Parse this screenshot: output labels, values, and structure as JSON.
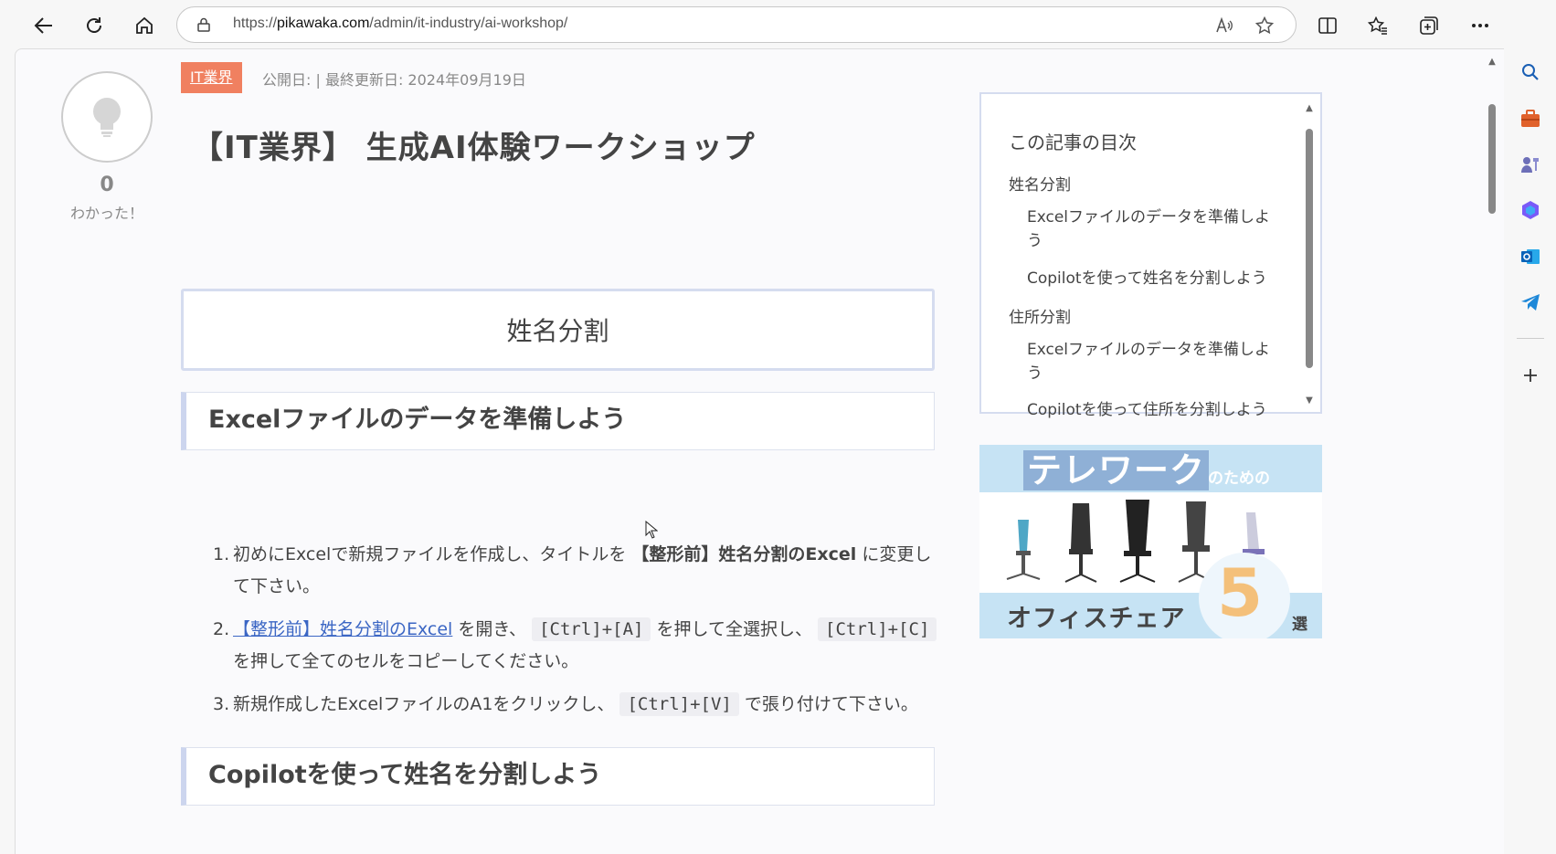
{
  "browser": {
    "url_prefix": "https://",
    "url_host": "pikawaka.com",
    "url_path": "/admin/it-industry/ai-workshop/",
    "icons": [
      "back-icon",
      "refresh-icon",
      "home-icon",
      "lock-icon",
      "read-aloud-icon",
      "favorite-star-icon",
      "split-screen-icon",
      "favorites-icon",
      "collections-icon",
      "more-icon",
      "copilot-icon"
    ],
    "sidebar_icons": [
      "search-icon",
      "tools-icon",
      "games-icon",
      "office-icon",
      "outlook-icon",
      "telegram-icon",
      "add-icon"
    ]
  },
  "article": {
    "category": "IT業界",
    "meta": "公開日:  |  最終更新日: 2024年09月19日",
    "title": "【IT業界】 生成AI体験ワークショップ",
    "like_count": "0",
    "like_label": "わかった！",
    "section_title": "姓名分割",
    "h3_1": "Excelファイルのデータを準備しよう",
    "h3_2": "Copilotを使って姓名を分割しよう",
    "steps": {
      "s1": {
        "num": "1.",
        "pre": "初めにExcelで新規ファイルを作成し、タイトルを ",
        "bold": "【整形前】姓名分割のExcel",
        "post": " に変更して下さい。"
      },
      "s2": {
        "num": "2.",
        "link": "【整形前】姓名分割のExcel",
        "mid1": " を開き、 ",
        "kbd1": "[Ctrl]+[A]",
        "mid2": " を押して全選択し、 ",
        "kbd2": "[Ctrl]+[C]",
        "post": " を押して全てのセルをコピーしてください。"
      },
      "s3": {
        "num": "3.",
        "pre": "新規作成したExcelファイルのA1をクリックし、 ",
        "kbd": "[Ctrl]+[V]",
        "post": " で張り付けて下さい。"
      }
    }
  },
  "toc": {
    "title": "この記事の目次",
    "item1": "姓名分割",
    "item2": "Excelファイルのデータを準備しよう",
    "item3": "Copilotを使って姓名を分割しよう",
    "item4": "住所分割",
    "item5": "Excelファイルのデータを準備しよう",
    "item6": "Copilotを使って住所を分割しよう"
  },
  "ad": {
    "headline": "テレワーク",
    "sub": "のための",
    "office": "オフィスチェア",
    "number": "5",
    "sen": "選"
  },
  "colors": {
    "badge": "#f08060",
    "link": "#3b66c4",
    "accent_border": "#d5dcef"
  }
}
